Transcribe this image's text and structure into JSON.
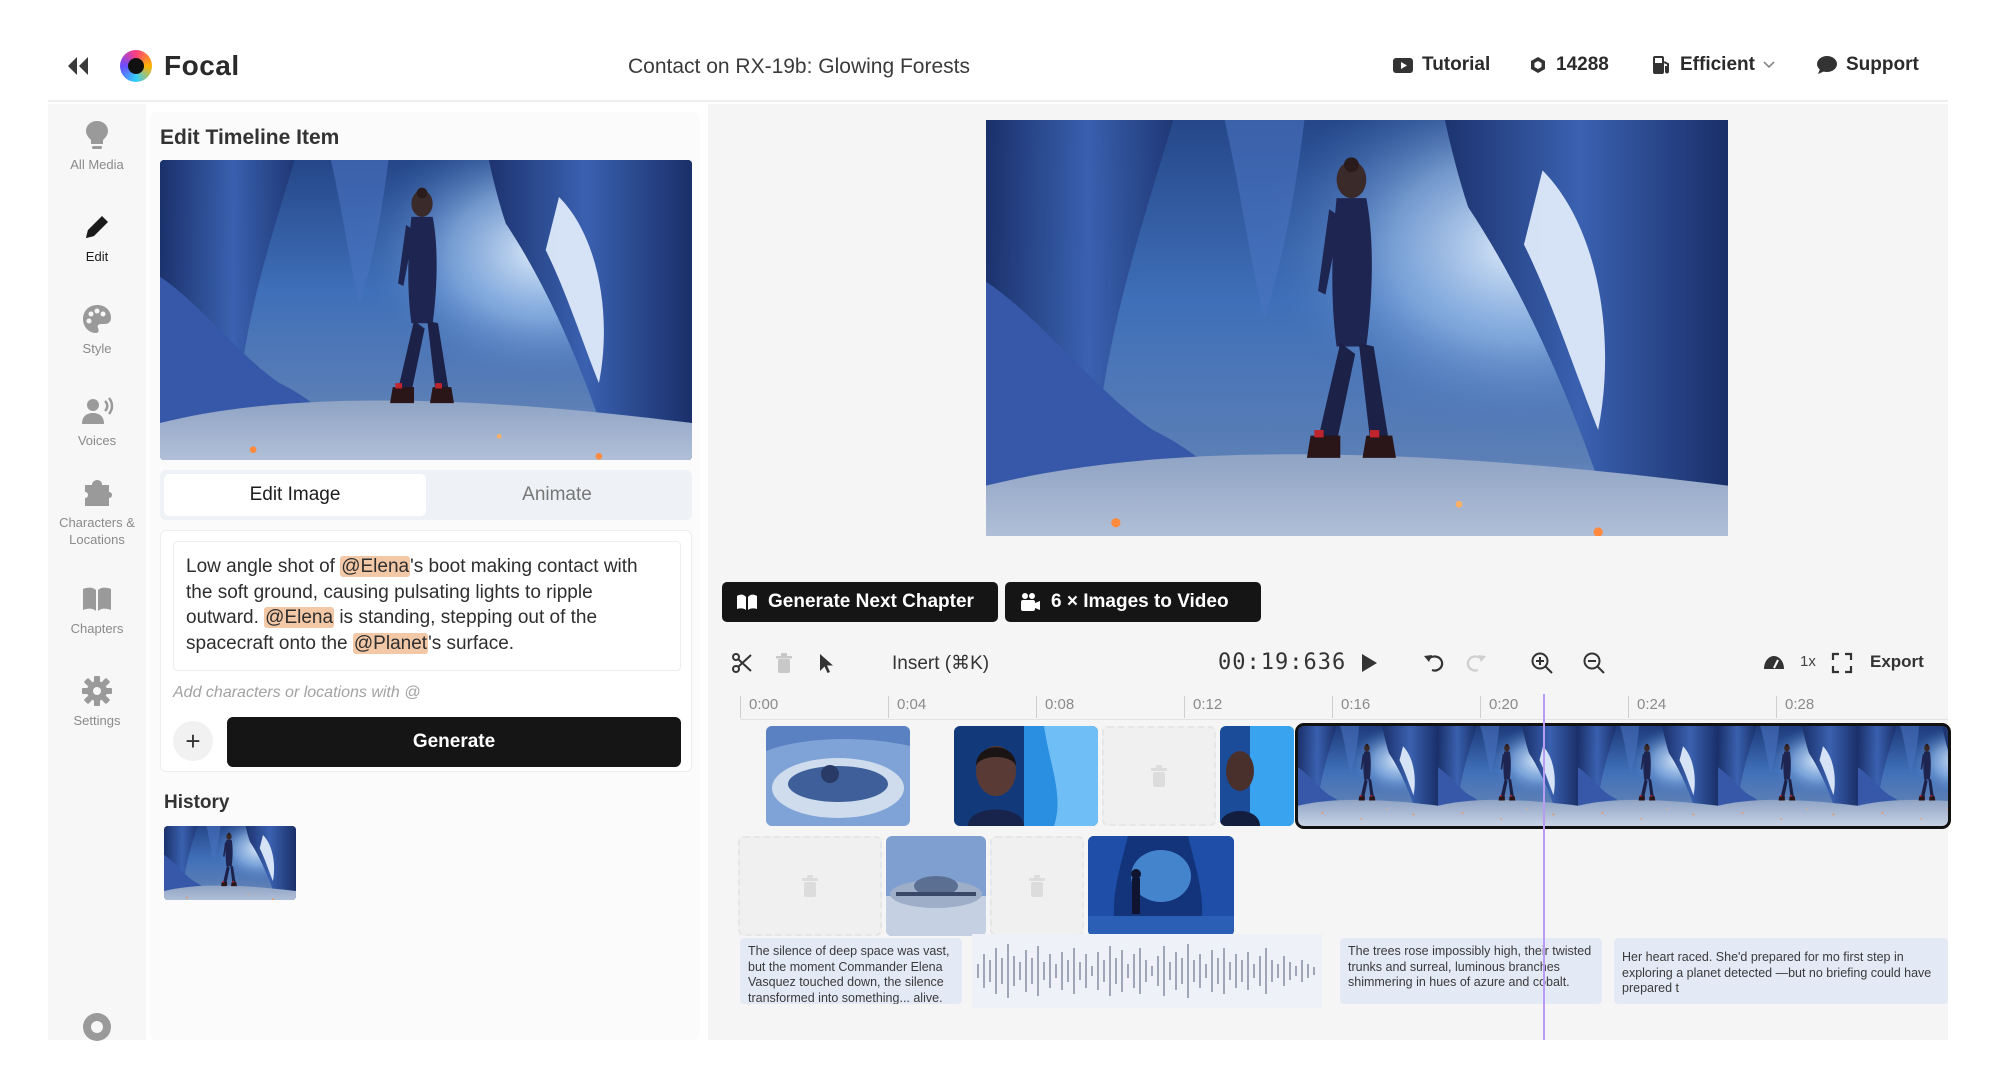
{
  "header": {
    "app_name": "Focal",
    "project_title": "Contact on RX-19b: Glowing Forests",
    "tutorial_label": "Tutorial",
    "credits": "14288",
    "mode_label": "Efficient",
    "support_label": "Support"
  },
  "sidebar": {
    "items": [
      {
        "label": "All Media",
        "icon": "lightbulb-icon"
      },
      {
        "label": "Edit",
        "icon": "pencil-icon"
      },
      {
        "label": "Style",
        "icon": "palette-icon"
      },
      {
        "label": "Voices",
        "icon": "voice-icon"
      },
      {
        "label": "Characters &",
        "label2": "Locations",
        "icon": "puzzle-icon"
      },
      {
        "label": "Chapters",
        "icon": "book-icon"
      },
      {
        "label": "Settings",
        "icon": "gear-icon"
      }
    ]
  },
  "edit_panel": {
    "title": "Edit Timeline Item",
    "tab_edit": "Edit Image",
    "tab_animate": "Animate",
    "prompt": {
      "p1": "Low angle shot of ",
      "m1": "@Elena",
      "p2": "'s boot making contact with the soft ground, causing pulsating lights to ripple outward. ",
      "m2": "@Elena",
      "p3": " is standing, stepping out of the spacecraft onto the ",
      "m3": "@Planet",
      "p4": "'s surface."
    },
    "hint": "Add characters or locations with @",
    "add_label": "+",
    "generate_label": "Generate",
    "history_title": "History"
  },
  "main": {
    "generate_next_label": "Generate Next Chapter",
    "images_to_video_label": "6 × Images to Video",
    "insert_label": "Insert (⌘K)",
    "timecode": "00:19:636",
    "speed": "1x",
    "export_label": "Export",
    "ruler": [
      "0:00",
      "0:04",
      "0:08",
      "0:12",
      "0:16",
      "0:20",
      "0:24",
      "0:28"
    ],
    "captions": [
      "The silence of deep space was vast, but the moment Commander Elena Vasquez touched down, the silence transformed into something... alive.",
      "The trees rose impossibly high, their twisted trunks and surreal, luminous branches shimmering in hues of azure and cobalt.",
      "Her heart raced. She'd prepared for mo first step in exploring a planet detected —but no briefing could have prepared t"
    ]
  },
  "colors": {
    "accent_dark": "#151515",
    "mention_highlight": "#f3c8a6",
    "playhead": "#b89cf3",
    "audio_bg": "#e4e9f6"
  }
}
